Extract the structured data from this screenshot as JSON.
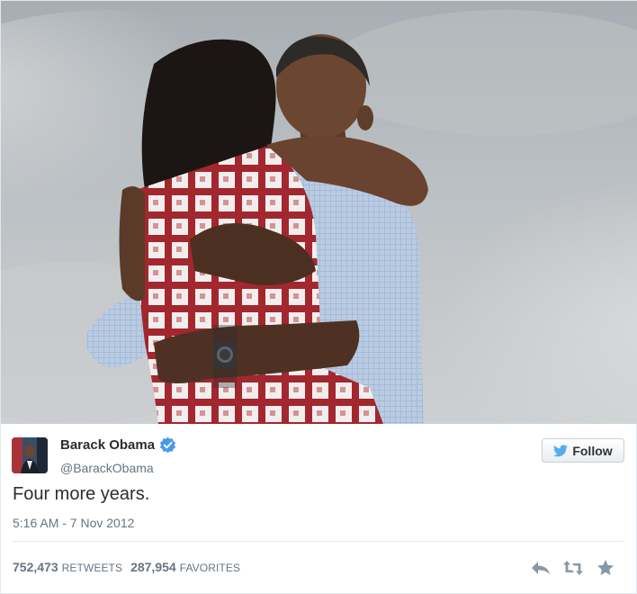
{
  "tweet": {
    "display_name": "Barack Obama",
    "screen_name": "@BarackObama",
    "text": "Four more years.",
    "timestamp": "5:16 AM - 7 Nov 2012",
    "verified": true
  },
  "follow_button": {
    "label": "Follow",
    "icon": "twitter-bird-icon"
  },
  "stats": {
    "retweets_count": "752,473",
    "retweets_label": "RETWEETS",
    "favorites_count": "287,954",
    "favorites_label": "FAVORITES"
  },
  "actions": [
    {
      "icon": "reply-icon"
    },
    {
      "icon": "retweet-icon"
    },
    {
      "icon": "favorite-star-icon"
    }
  ],
  "colors": {
    "verified_blue": "#4a99e9",
    "twitter_blue": "#55acee",
    "muted_text": "#66757f",
    "divider": "#e1e8ed"
  }
}
